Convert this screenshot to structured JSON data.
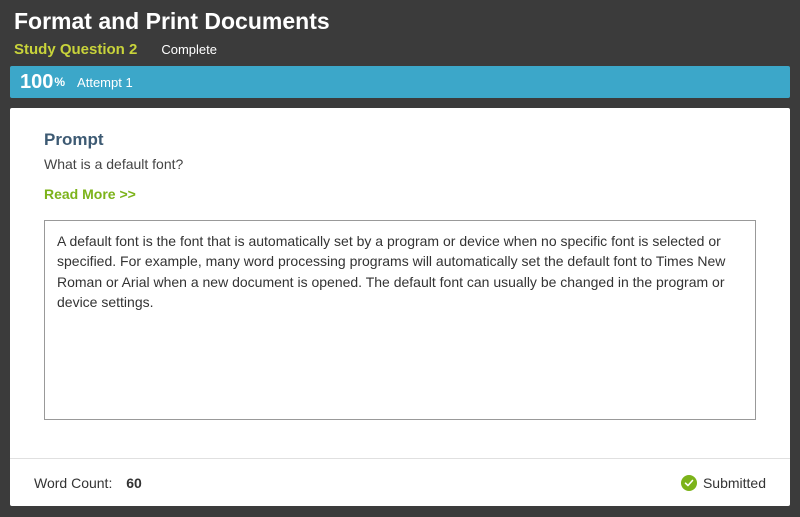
{
  "header": {
    "title": "Format and Print Documents",
    "study_question": "Study Question 2",
    "status": "Complete"
  },
  "scorebar": {
    "score": "100",
    "percent": "%",
    "attempt": "Attempt 1"
  },
  "prompt": {
    "heading": "Prompt",
    "question": "What is a default font?",
    "read_more": "Read More >>"
  },
  "answer": {
    "text": "A default font is the font that is automatically set by a program or device when no specific font is selected or specified. For example, many word processing programs will automatically set the default font to Times New Roman or Arial when a new document is opened. The default font can usually be changed in the program or device settings."
  },
  "footer": {
    "word_count_label": "Word Count:",
    "word_count_value": "60",
    "submitted_label": "Submitted"
  }
}
